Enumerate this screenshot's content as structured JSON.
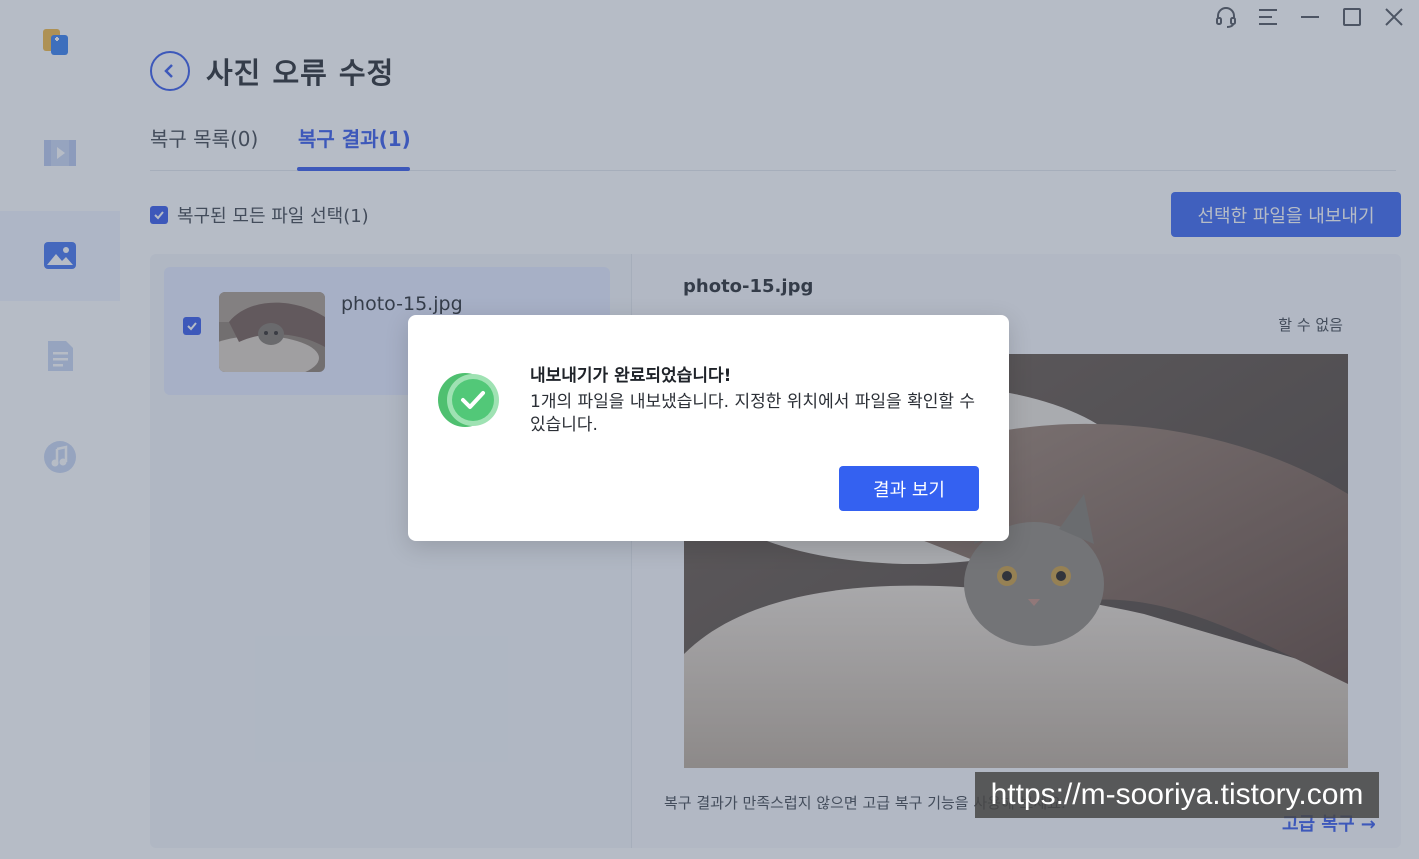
{
  "window": {
    "controls": {
      "support_icon": "headset-icon",
      "menu_icon": "menu-icon",
      "minimize_icon": "minimize-icon",
      "maximize_icon": "maximize-icon",
      "close_icon": "close-icon"
    }
  },
  "sidebar": {
    "items": [
      {
        "icon": "video-icon",
        "active": false
      },
      {
        "icon": "photo-icon",
        "active": true
      },
      {
        "icon": "document-icon",
        "active": false
      },
      {
        "icon": "music-icon",
        "active": false
      }
    ]
  },
  "header": {
    "title": "사진 오류 수정"
  },
  "tabs": [
    {
      "label": "복구 목록(0)",
      "active": false
    },
    {
      "label": "복구 결과(1)",
      "active": true
    }
  ],
  "toolbar": {
    "select_all_label": "복구된 모든 파일 선택(1)",
    "select_all_checked": true,
    "export_label": "선택한 파일을 내보내기"
  },
  "file_list": [
    {
      "name": "photo-15.jpg",
      "checked": true
    }
  ],
  "preview": {
    "file_name": "photo-15.jpg",
    "note": "할 수 없음",
    "hint": "복구 결과가 만족스럽지 않으면 고급 복구 기능을 사용해 보세요.",
    "advanced_link": "고급 복구",
    "advanced_arrow": "→"
  },
  "watermark": "https://m-sooriya.tistory.com",
  "modal": {
    "title": "내보내기가 완료되었습니다!",
    "message": "1개의 파일을 내보냈습니다. 지정한 위치에서 파일을 확인할 수 있습니다.",
    "button_label": "결과 보기"
  },
  "colors": {
    "accent": "#2f54eb",
    "button": "#3461f1",
    "success": "#52c878"
  }
}
